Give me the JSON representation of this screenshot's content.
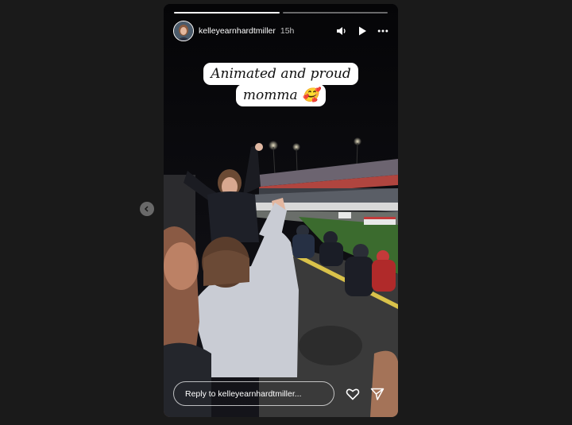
{
  "story": {
    "username": "kelleyearnhardtmiller",
    "time_ago": "15h",
    "progress": [
      1,
      0
    ],
    "caption_lines": [
      "Animated and proud",
      "momma 🥰"
    ],
    "reply_placeholder": "Reply to kelleyearnhardtmiller...",
    "icons": {
      "sound": "volume-icon",
      "play": "play-icon",
      "more": "more-icon",
      "like": "heart-icon",
      "share": "send-icon",
      "previous": "chevron-left-icon"
    }
  }
}
